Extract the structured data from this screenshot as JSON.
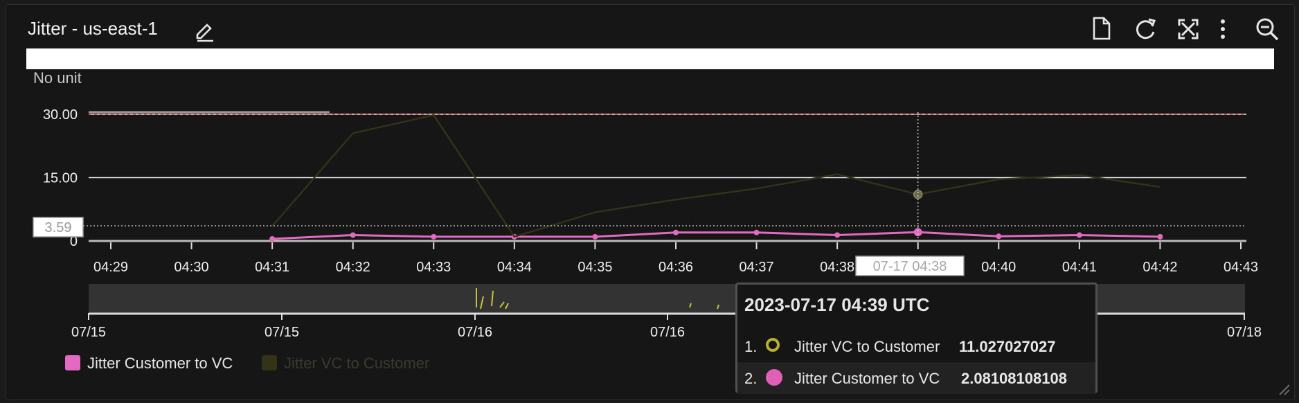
{
  "window": {
    "title": "Jitter - us-east-1"
  },
  "toolbar": {
    "icons": [
      "edit-icon",
      "document-icon",
      "refresh-icon",
      "expand-icon",
      "more-vertical-icon",
      "zoom-out-icon"
    ]
  },
  "chart_data": {
    "type": "line",
    "unit_label": "No unit",
    "x": [
      "04:29",
      "04:30",
      "04:31",
      "04:32",
      "04:33",
      "04:34",
      "04:35",
      "04:36",
      "04:37",
      "04:38",
      "04:39",
      "04:40",
      "04:41",
      "04:42",
      "04:43"
    ],
    "x_tick_labels": [
      "04:29",
      "04:30",
      "04:31",
      "04:32",
      "04:33",
      "04:34",
      "04:35",
      "04:36",
      "04:37",
      "04:38",
      "04:40",
      "04:41",
      "04:42",
      "04:43"
    ],
    "y_ticks": [
      "30.00",
      "15.00",
      "0"
    ],
    "ylim": [
      0,
      30
    ],
    "threshold": 30,
    "series": [
      {
        "name": "Jitter Customer to VC",
        "color": "#e26ac2",
        "x": [
          "04:31",
          "04:32",
          "04:33",
          "04:34",
          "04:35",
          "04:36",
          "04:37",
          "04:38",
          "04:39",
          "04:40",
          "04:41",
          "04:42"
        ],
        "values": [
          0.5,
          1.4,
          1.0,
          1.0,
          1.0,
          2.0,
          2.0,
          1.4,
          2.08108108108,
          1.1,
          1.4,
          1.0
        ]
      },
      {
        "name": "Jitter VC to Customer",
        "color": "#333318",
        "x": [
          "04:31",
          "04:32",
          "04:33",
          "04:34",
          "04:35",
          "04:36",
          "04:37",
          "04:38",
          "04:39",
          "04:40",
          "04:41",
          "04:42"
        ],
        "values": [
          3.5,
          25.5,
          29.8,
          1.0,
          6.8,
          9.8,
          12.4,
          15.8,
          11.027027027,
          14.6,
          15.6,
          12.8
        ]
      }
    ],
    "crosshair": {
      "x": "04:39",
      "x_label": "07-17 04:38",
      "y_label": "3.59",
      "y_value": 3.59
    },
    "navigator": {
      "labels": [
        "07/15",
        "07/15",
        "07/16",
        "07/16",
        "07/18"
      ]
    },
    "legend": [
      {
        "name": "Jitter Customer to VC",
        "color": "#e26ac2"
      },
      {
        "name": "Jitter VC to Customer",
        "color": "#333318"
      }
    ]
  },
  "tooltip": {
    "timestamp": "2023-07-17 04:39 UTC",
    "rows": [
      {
        "num": "1.",
        "name": "Jitter VC to Customer",
        "value": "11.027027027"
      },
      {
        "num": "2.",
        "name": "Jitter Customer to VC",
        "value": "2.08108108108"
      }
    ]
  }
}
